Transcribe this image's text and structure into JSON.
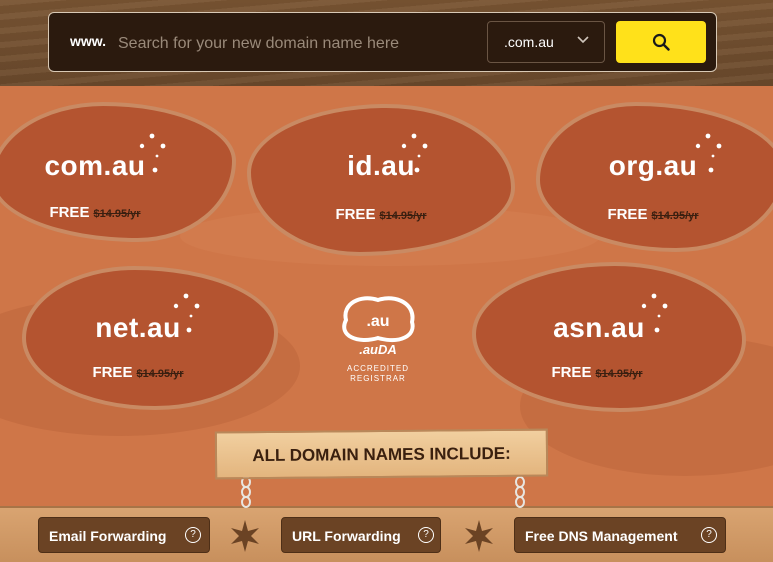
{
  "search": {
    "prefix": "www.",
    "placeholder": "Search for your new domain name here",
    "tld_selected": "com.au"
  },
  "domains": [
    {
      "name": "com.au",
      "free_label": "FREE",
      "old_price": "$14.95/yr"
    },
    {
      "name": "id.au",
      "free_label": "FREE",
      "old_price": "$14.95/yr"
    },
    {
      "name": "org.au",
      "free_label": "FREE",
      "old_price": "$14.95/yr"
    },
    {
      "name": "net.au",
      "free_label": "FREE",
      "old_price": "$14.95/yr"
    },
    {
      "name": "asn.au",
      "free_label": "FREE",
      "old_price": "$14.95/yr"
    }
  ],
  "auda": {
    "logo_text": ".au",
    "brand": ".auDA",
    "accredited_line1": "ACCREDITED",
    "accredited_line2": "REGISTRAR"
  },
  "includes_heading": "ALL DOMAIN NAMES INCLUDE:",
  "features": [
    {
      "label": "Email Forwarding"
    },
    {
      "label": "URL Forwarding"
    },
    {
      "label": "Free DNS Management"
    }
  ],
  "colors": {
    "search_button": "#ffe11a",
    "ground": "#cf7648",
    "blob": "#b45430",
    "feature_button": "#6b4324"
  },
  "icons": {
    "search": "search-icon",
    "chevron": "chevron-down-icon",
    "help": "help-circle-icon",
    "star": "southern-cross-stars-icon"
  }
}
